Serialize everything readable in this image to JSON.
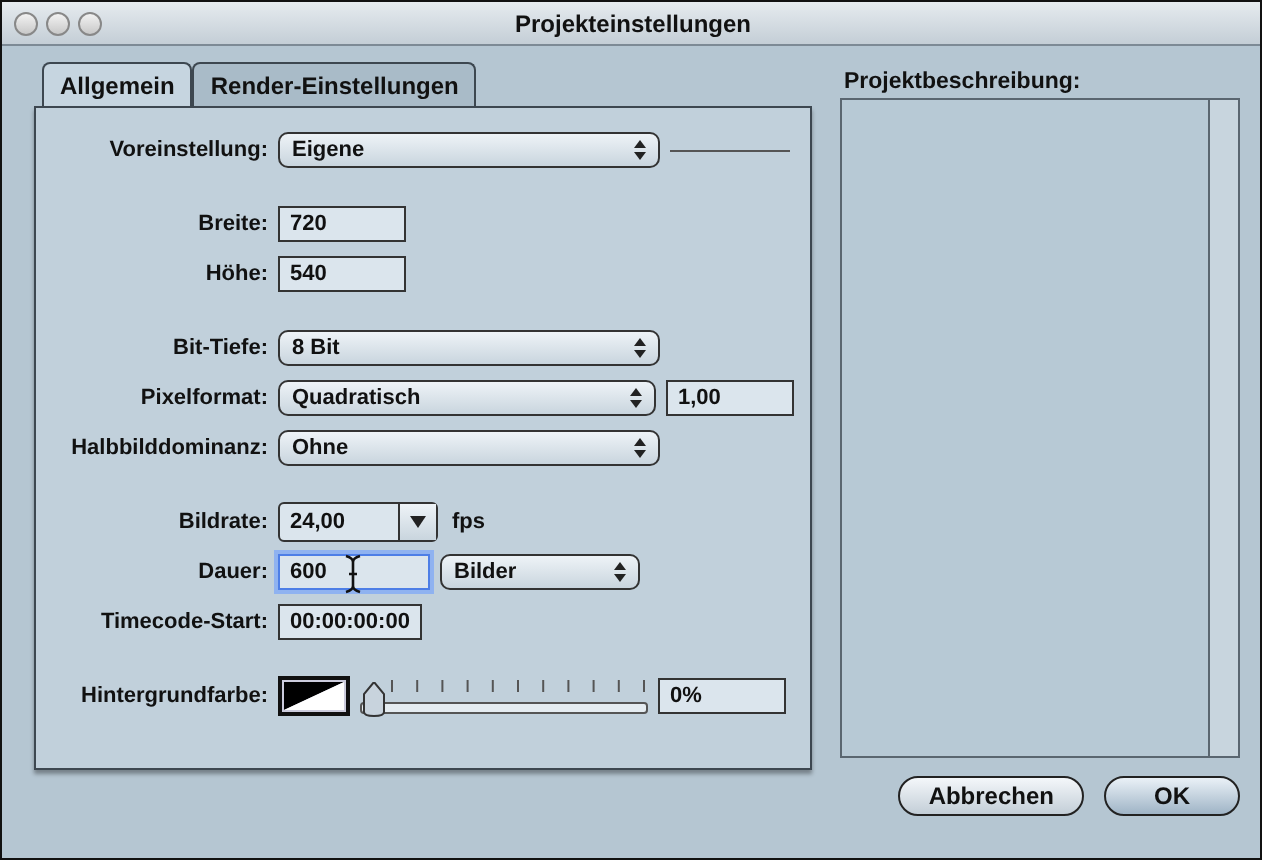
{
  "window": {
    "title": "Projekteinstellungen"
  },
  "tabs": [
    {
      "label": "Allgemein",
      "selected": true
    },
    {
      "label": "Render-Einstellungen",
      "selected": false
    }
  ],
  "groups": [
    [
      {
        "label": "Voreinstellung:",
        "controls": [
          {
            "kind": "popup",
            "value": "Eigene"
          },
          {
            "kind": "separator"
          }
        ]
      }
    ],
    [
      {
        "label": "Breite:",
        "controls": [
          {
            "kind": "field",
            "value": "720",
            "focused": false
          }
        ]
      },
      {
        "label": "Höhe:",
        "controls": [
          {
            "kind": "field",
            "value": "540",
            "focused": false
          }
        ]
      }
    ],
    [
      {
        "label": "Bit-Tiefe:",
        "controls": [
          {
            "kind": "popup",
            "value": "8 Bit"
          }
        ]
      },
      {
        "label": "Pixelformat:",
        "controls": [
          {
            "kind": "popup",
            "value": "Quadratisch"
          },
          {
            "kind": "field",
            "value": "1,00",
            "focused": false
          }
        ]
      },
      {
        "label": "Halbbilddominanz:",
        "controls": [
          {
            "kind": "popup",
            "value": "Ohne"
          }
        ]
      }
    ],
    [
      {
        "label": "Bildrate:",
        "controls": [
          {
            "kind": "combo",
            "value": "24,00"
          },
          {
            "kind": "unit",
            "text": "fps"
          }
        ]
      },
      {
        "label": "Dauer:",
        "controls": [
          {
            "kind": "field",
            "value": "600",
            "focused": true
          },
          {
            "kind": "small_popup",
            "value": "Bilder"
          }
        ]
      },
      {
        "label": "Timecode-Start:",
        "controls": [
          {
            "kind": "field",
            "value": "00:00:00:00",
            "focused": false
          }
        ]
      }
    ],
    [
      {
        "label": "Hintergrundfarbe:",
        "controls": [
          {
            "kind": "color_well"
          },
          {
            "kind": "slider",
            "level": 0
          },
          {
            "kind": "small_field",
            "value": "0%"
          }
        ]
      }
    ]
  ],
  "description": {
    "label": "Projektbeschreibung:"
  },
  "buttons": [
    {
      "label": "Abbrechen",
      "default": false
    },
    {
      "label": "OK",
      "default": true
    }
  ]
}
